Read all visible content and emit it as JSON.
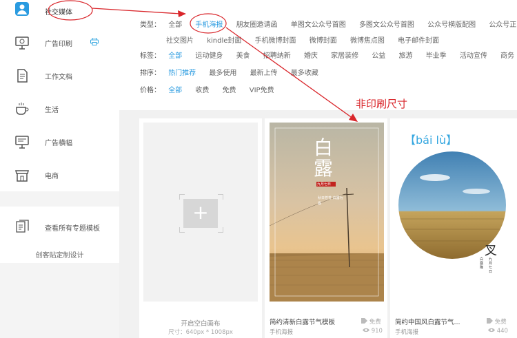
{
  "sidebar": {
    "items": [
      {
        "label": "社交媒体",
        "icon": "user-badge-icon"
      },
      {
        "label": "广告印刷",
        "icon": "monitor-ad-icon"
      },
      {
        "label": "工作文档",
        "icon": "document-icon"
      },
      {
        "label": "生活",
        "icon": "coffee-cup-icon"
      },
      {
        "label": "广告横幅",
        "icon": "display-banner-icon"
      },
      {
        "label": "电商",
        "icon": "shop-icon"
      }
    ],
    "print_badge": "printer-icon",
    "all_topics": "查看所有专题模板",
    "custom_design": "创客贴定制设计"
  },
  "filters": {
    "type": {
      "label": "类型：",
      "row1": [
        "全部",
        "手机海报",
        "朋友圈邀请函",
        "单图文公众号首图",
        "多图文公众号首图",
        "公众号横版配图",
        "公众号正"
      ],
      "row2": [
        "社交图片",
        "kindle封面",
        "手机微博封面",
        "微博封面",
        "微博焦点图",
        "电子邮件封面"
      ]
    },
    "tags": {
      "label": "标签：",
      "options": [
        "全部",
        "运动健身",
        "美食",
        "招聘纳新",
        "婚庆",
        "家居装修",
        "公益",
        "旅游",
        "毕业季",
        "活动宣传",
        "商务"
      ]
    },
    "sort": {
      "label": "排序：",
      "options": [
        "热门推荐",
        "最多使用",
        "最新上传",
        "最多收藏"
      ]
    },
    "price": {
      "label": "价格：",
      "options": [
        "全部",
        "收费",
        "免费",
        "VIP免费"
      ]
    }
  },
  "annotation": {
    "text": "非印刷尺寸",
    "color": "#d9262b"
  },
  "cards": [
    {
      "title": "开启空白画布",
      "meta": "尺寸：640px * 1008px"
    },
    {
      "title": "简约清新白露节气模板",
      "category": "手机海报",
      "price": "免费",
      "views": "910",
      "poster": {
        "big1": "白",
        "big2": "露",
        "seal": "九月七日",
        "verse": "秋日苍苍 白露为霜"
      }
    },
    {
      "title": "简约中国风白露节气...",
      "category": "手机海报",
      "price": "免费",
      "views": "440",
      "poster": {
        "pinyin": "【bái lù】",
        "glyph": "叉",
        "date": "九月七日",
        "verse": "白露降"
      }
    }
  ],
  "colors": {
    "accent": "#2a9be0",
    "annotation": "#d9262b"
  }
}
